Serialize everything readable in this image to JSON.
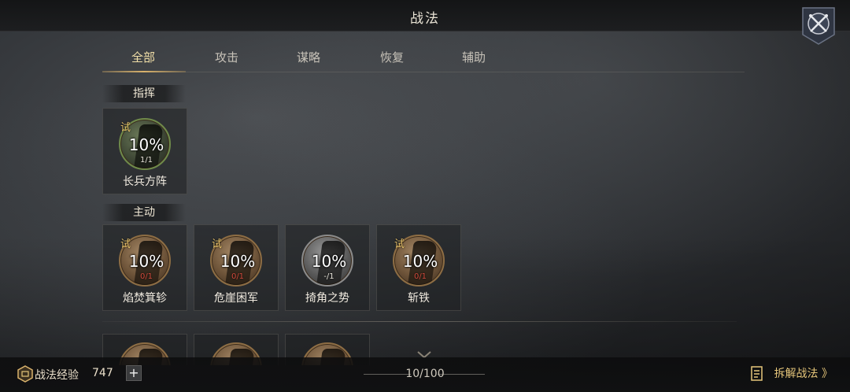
{
  "header": {
    "title": "战法"
  },
  "tabs": [
    {
      "label": "全部",
      "active": true
    },
    {
      "label": "攻击",
      "active": false
    },
    {
      "label": "谋略",
      "active": false
    },
    {
      "label": "恢复",
      "active": false
    },
    {
      "label": "辅助",
      "active": false
    }
  ],
  "sections": [
    {
      "label": "指挥",
      "cards": [
        {
          "name": "长兵方阵",
          "trial": "试",
          "percent": "10%",
          "count": "1/1",
          "count_color": "normal",
          "medal": "green"
        }
      ]
    },
    {
      "label": "主动",
      "cards": [
        {
          "name": "焰焚箕轸",
          "trial": "试",
          "percent": "10%",
          "count": "0/1",
          "count_color": "red",
          "medal": "bronze"
        },
        {
          "name": "危崖困军",
          "trial": "试",
          "percent": "10%",
          "count": "0/1",
          "count_color": "red",
          "medal": "bronze"
        },
        {
          "name": "掎角之势",
          "trial": "",
          "percent": "10%",
          "count": "-/1",
          "count_color": "normal",
          "medal": "grey"
        },
        {
          "name": "斩铁",
          "trial": "试",
          "percent": "10%",
          "count": "0/1",
          "count_color": "red",
          "medal": "bronze"
        }
      ]
    }
  ],
  "footer": {
    "exp_label": "战法经验",
    "exp_value": "747",
    "plus_label": "+",
    "page_counter": "10/100",
    "decompose_label": "拆解战法 》"
  },
  "colors": {
    "accent_gold": "#d9b26c",
    "count_red": "#d14a3c",
    "trial_gold": "#e8c36a"
  }
}
